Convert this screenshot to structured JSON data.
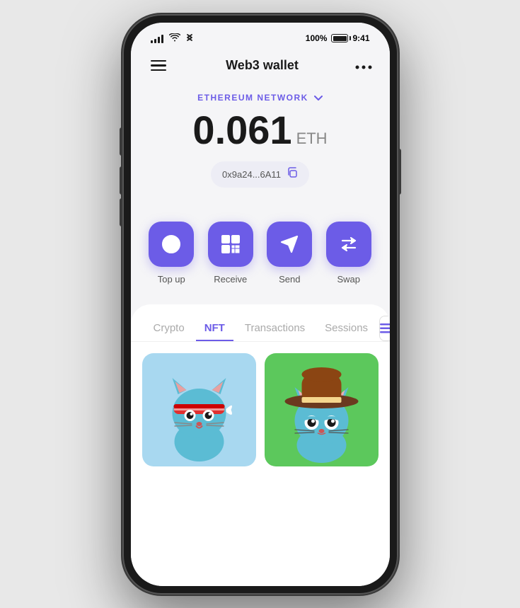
{
  "status_bar": {
    "time": "9:41",
    "battery": "100%",
    "signal_bars": [
      4,
      6,
      9,
      12,
      14
    ]
  },
  "header": {
    "title": "Web3 wallet",
    "menu_icon": "hamburger",
    "more_icon": "ellipsis"
  },
  "balance": {
    "network": "ETHEREUM NETWORK",
    "amount": "0.061",
    "currency": "ETH",
    "address": "0x9a24...6A11",
    "copy_tooltip": "Copy address"
  },
  "actions": [
    {
      "id": "topup",
      "label": "Top up",
      "icon": "bitcoin-circle"
    },
    {
      "id": "receive",
      "label": "Receive",
      "icon": "qr-code"
    },
    {
      "id": "send",
      "label": "Send",
      "icon": "send-arrow"
    },
    {
      "id": "swap",
      "label": "Swap",
      "icon": "swap-arrows"
    }
  ],
  "tabs": [
    {
      "id": "crypto",
      "label": "Crypto",
      "active": false
    },
    {
      "id": "nft",
      "label": "NFT",
      "active": true
    },
    {
      "id": "transactions",
      "label": "Transactions",
      "active": false
    },
    {
      "id": "sessions",
      "label": "Sessions",
      "active": false
    }
  ],
  "nft_items": [
    {
      "id": "nft-1",
      "bg": "#a8d8f0",
      "name": "Ninja Cat"
    },
    {
      "id": "nft-2",
      "bg": "#4dbf4d",
      "name": "Cowboy Cat"
    }
  ],
  "colors": {
    "accent": "#6c5ce7",
    "background": "#f5f5f7",
    "card_bg": "#ffffff"
  }
}
